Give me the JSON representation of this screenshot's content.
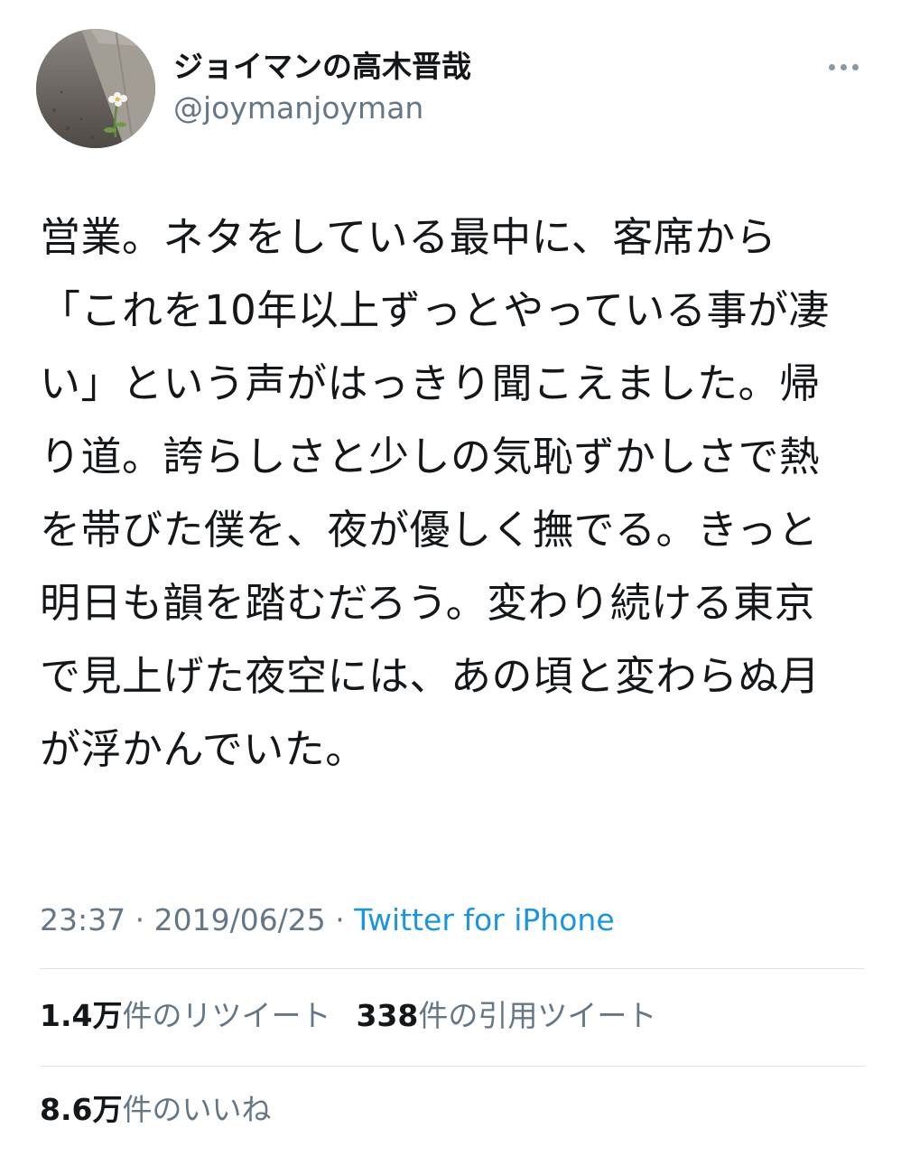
{
  "user": {
    "display_name": "ジョイマンの高木晋哉",
    "handle": "@joymanjoyman"
  },
  "tweet": {
    "text": "営業。ネタをしている最中に、客席から「これを10年以上ずっとやっている事が凄い」という声がはっきり聞こえました。帰り道。誇らしさと少しの気恥ずかしさで熱を帯びた僕を、夜が優しく撫でる。きっと明日も韻を踏むだろう。変わり続ける東京で見上げた夜空には、あの頃と変わらぬ月が浮かんでいた。",
    "time": "23:37",
    "separator1": " · ",
    "date": "2019/06/25",
    "separator2": " · ",
    "source": "Twitter for iPhone"
  },
  "stats": {
    "retweets_count": "1.4万",
    "retweets_label": "件のリツイート",
    "quotes_count": "338",
    "quotes_label": "件の引用ツイート",
    "likes_count": "8.6万",
    "likes_label": "件のいいね"
  },
  "icons": {
    "more": "more-horizontal-icon"
  },
  "colors": {
    "text": "#14171a",
    "muted": "#657786",
    "link": "#1b95e0",
    "divider": "#dfe3e6"
  }
}
